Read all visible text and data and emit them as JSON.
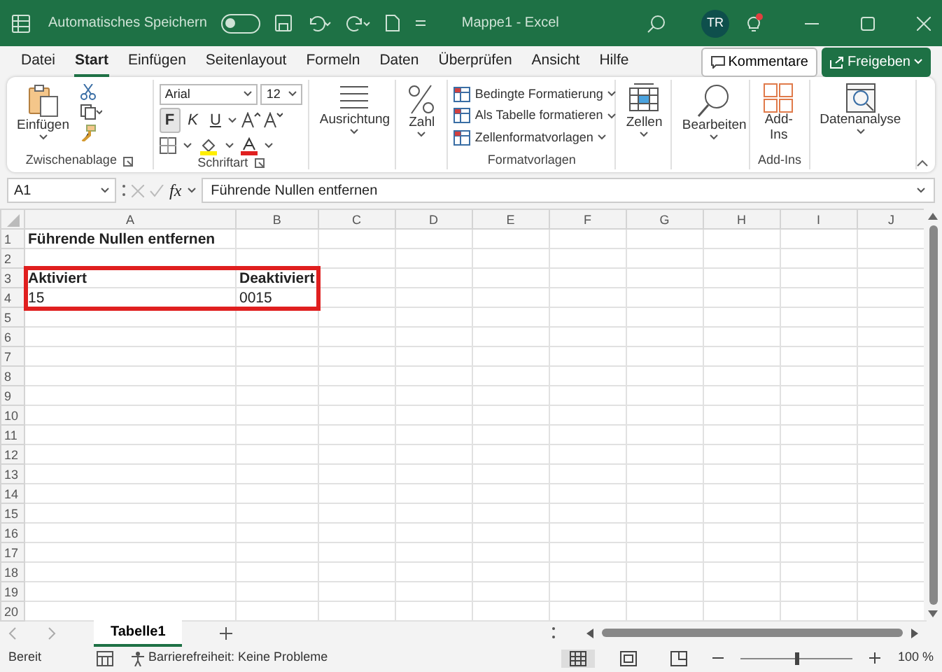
{
  "title_bar": {
    "autosave_label": "Automatisches Speichern",
    "autosave_on": false,
    "title": "Mappe1 - Excel",
    "avatar": "TR"
  },
  "menu_tabs": [
    {
      "label": "Datei",
      "selected": false
    },
    {
      "label": "Start",
      "selected": true
    },
    {
      "label": "Einfügen",
      "selected": false
    },
    {
      "label": "Seitenlayout",
      "selected": false
    },
    {
      "label": "Formeln",
      "selected": false
    },
    {
      "label": "Daten",
      "selected": false
    },
    {
      "label": "Überprüfen",
      "selected": false
    },
    {
      "label": "Ansicht",
      "selected": false
    },
    {
      "label": "Hilfe",
      "selected": false
    }
  ],
  "comment_button": "Kommentare",
  "share_button": "Freigeben",
  "ribbon": {
    "groups": [
      {
        "kind": "clipboard",
        "label": "Zwischenablage",
        "button": "Einfügen"
      },
      {
        "kind": "font",
        "label": "Schriftart",
        "font": "Arial",
        "size": "12",
        "style_buttons": [
          {
            "label": "F",
            "selected": true
          },
          {
            "label": "K",
            "selected": false
          },
          {
            "label": "U",
            "selected": false
          }
        ]
      },
      {
        "kind": "alignment",
        "button": "Ausrichtung"
      },
      {
        "kind": "number",
        "button": "Zahl"
      },
      {
        "kind": "styles",
        "label": "Formatvorlagen",
        "items": [
          "Bedingte Formatierung",
          "Als Tabelle formatieren",
          "Zellenformatvorlagen"
        ]
      },
      {
        "kind": "cells",
        "button": "Zellen"
      },
      {
        "kind": "editing",
        "button": "Bearbeiten"
      },
      {
        "kind": "addins",
        "label": "Add-Ins",
        "button": "Add-Ins"
      },
      {
        "kind": "analysis",
        "button": "Datenanalyse"
      }
    ]
  },
  "formula_bar": {
    "name_box": "A1",
    "function_label": "fx",
    "formula": "Führende Nullen entfernen"
  },
  "sheet": {
    "columns": [
      "A",
      "B",
      "C",
      "D",
      "E",
      "F",
      "G",
      "H",
      "I",
      "J"
    ],
    "rows": [
      {
        "header": "1",
        "cells": [
          {
            "text": "Führende Nullen entfernen",
            "bold": true,
            "highlighted": false
          }
        ]
      },
      {
        "header": "2"
      },
      {
        "header": "3",
        "cells": [
          {
            "text": "Aktiviert",
            "bold": true,
            "highlighted": true
          },
          {
            "text": "Deaktiviert",
            "bold": true,
            "highlighted": true
          }
        ]
      },
      {
        "header": "4",
        "cells": [
          {
            "text": "15",
            "bold": false,
            "highlighted": true
          },
          {
            "text": "0015",
            "bold": false,
            "highlighted": true
          }
        ]
      },
      {
        "header": "5"
      },
      {
        "header": "6"
      },
      {
        "header": "7"
      },
      {
        "header": "8"
      },
      {
        "header": "9"
      },
      {
        "header": "10"
      },
      {
        "header": "11"
      },
      {
        "header": "12"
      },
      {
        "header": "13"
      },
      {
        "header": "14"
      },
      {
        "header": "15"
      },
      {
        "header": "16"
      },
      {
        "header": "17"
      },
      {
        "header": "18"
      },
      {
        "header": "19"
      },
      {
        "header": "20"
      }
    ]
  },
  "sheet_tabs": [
    {
      "label": "Tabelle1",
      "selected": true
    }
  ],
  "status_bar": {
    "status": "Bereit",
    "accessibility": "Barrierefreiheit: Keine Probleme",
    "views": [
      {
        "kind": "normal",
        "selected": true
      },
      {
        "kind": "page_layout",
        "selected": false
      },
      {
        "kind": "page_break",
        "selected": false
      }
    ],
    "zoom": {
      "level": 0.5,
      "reading": "100 %"
    }
  }
}
